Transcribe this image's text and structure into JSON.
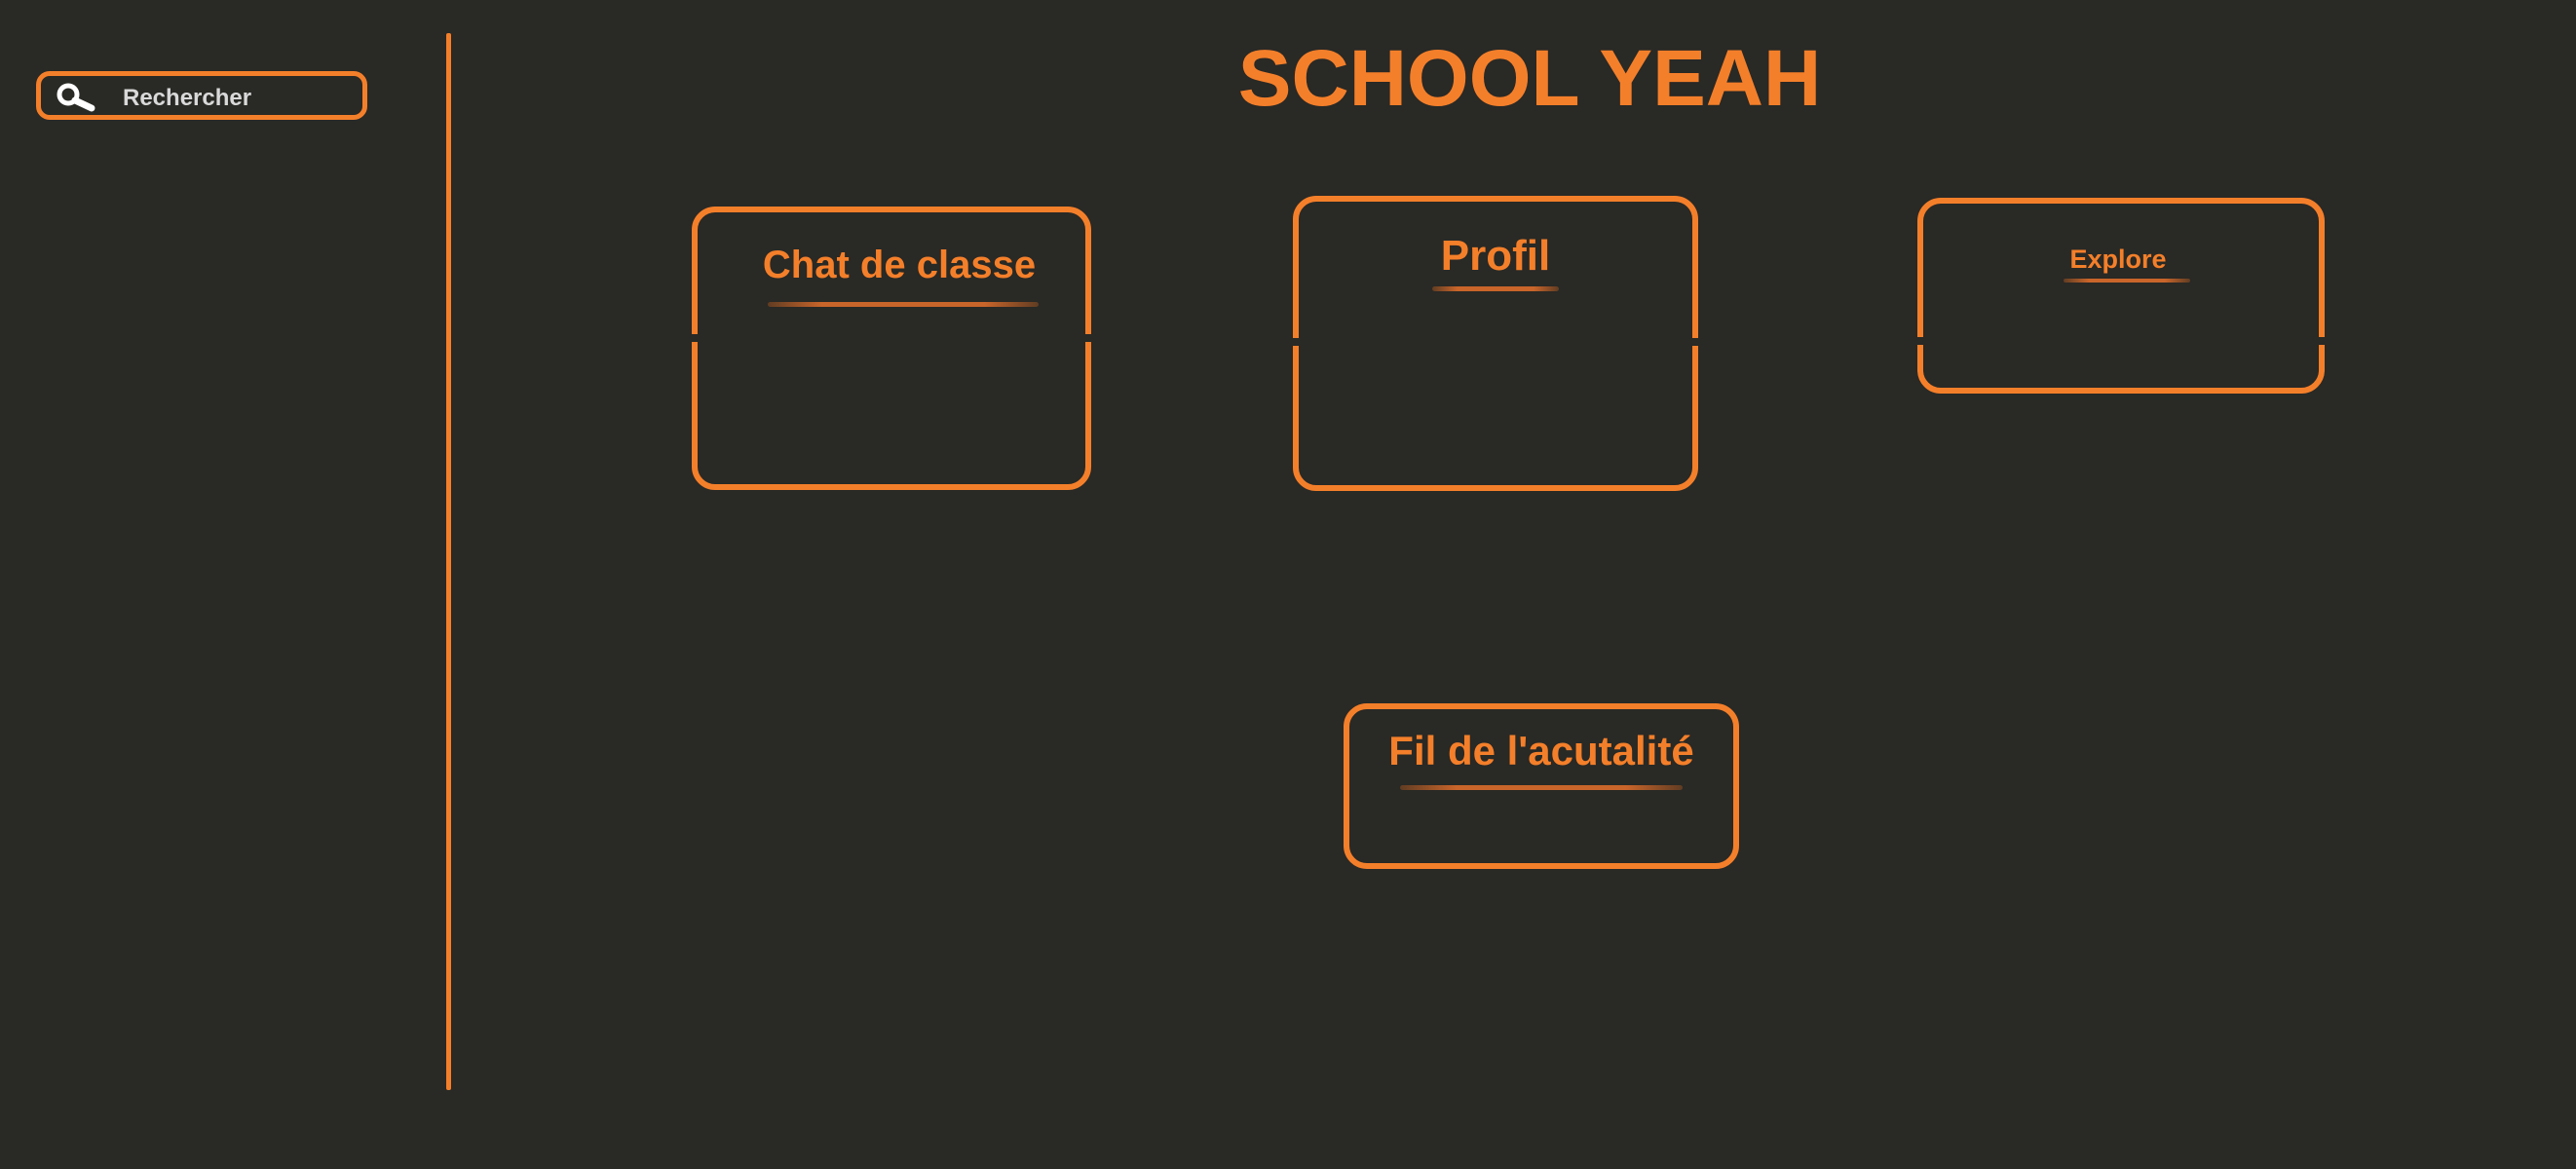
{
  "colors": {
    "background": "#292925",
    "accent": "#f47f2a",
    "search_text": "#d9d9d9"
  },
  "search": {
    "icon": "search-icon",
    "label": "Rechercher"
  },
  "header": {
    "title": "SCHOOL YEAH"
  },
  "cards": {
    "chat": {
      "title": "Chat de classe"
    },
    "profile": {
      "title": "Profil"
    },
    "explore": {
      "title": "Explore"
    },
    "news": {
      "title": "Fil de l'acutalité"
    }
  }
}
